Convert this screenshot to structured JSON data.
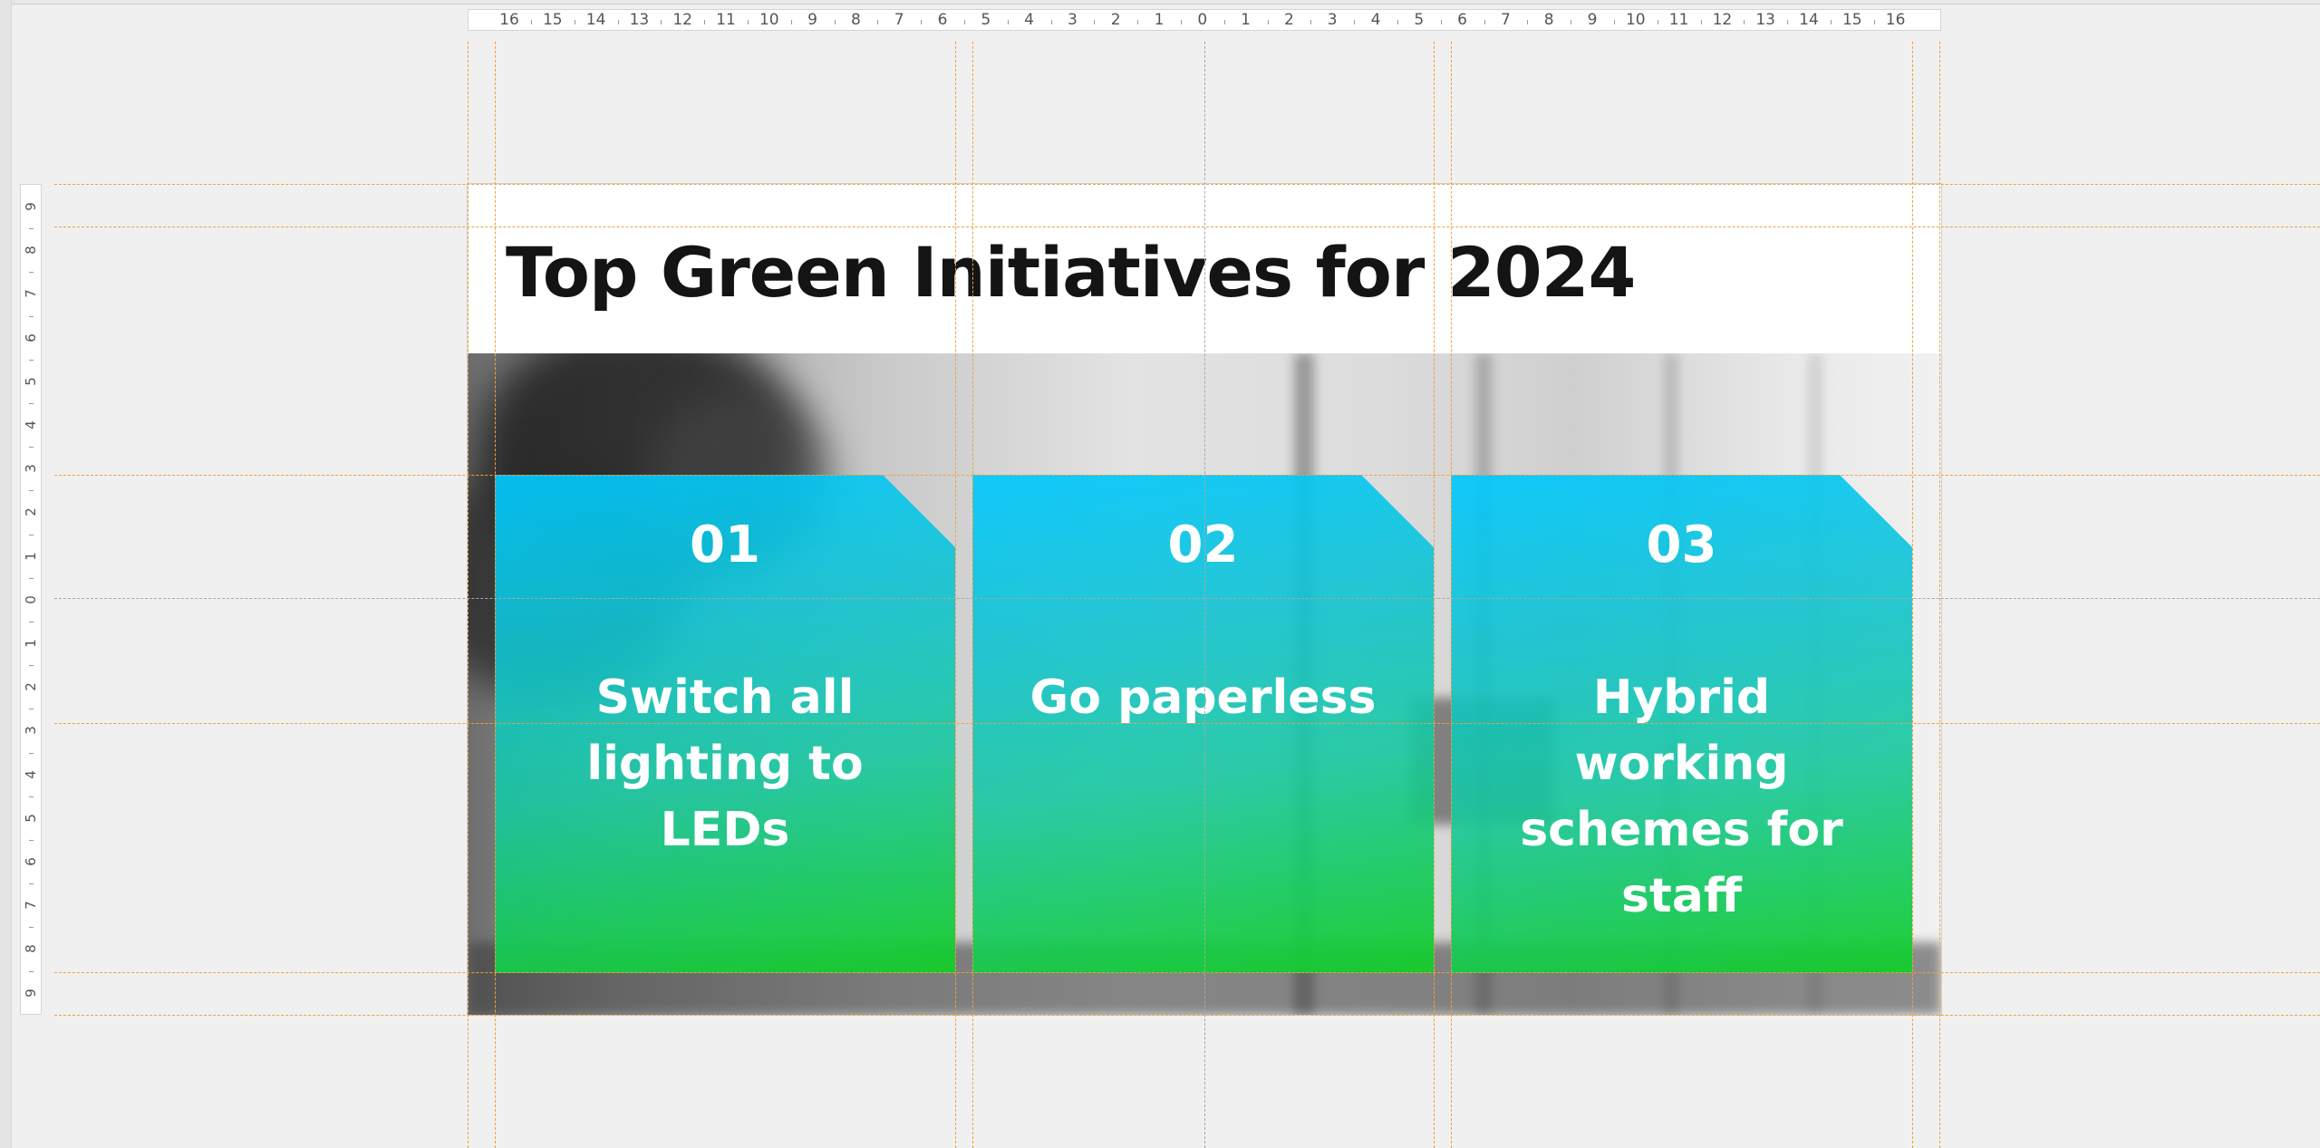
{
  "slide": {
    "title": "Top Green Initiatives for 2024"
  },
  "cards": [
    {
      "number": "01",
      "label": "Switch all lighting to LEDs"
    },
    {
      "number": "02",
      "label": "Go paperless"
    },
    {
      "number": "03",
      "label": "Hybrid working schemes for staff"
    }
  ],
  "ruler": {
    "horizontal_labels": [
      "16",
      "15",
      "14",
      "13",
      "12",
      "11",
      "10",
      "9",
      "8",
      "7",
      "6",
      "5",
      "4",
      "3",
      "2",
      "1",
      "0",
      "1",
      "2",
      "3",
      "4",
      "5",
      "6",
      "7",
      "8",
      "9",
      "10",
      "11",
      "12",
      "13",
      "14",
      "15",
      "16"
    ],
    "vertical_labels": [
      "9",
      "8",
      "7",
      "6",
      "5",
      "4",
      "3",
      "2",
      "1",
      "0",
      "1",
      "2",
      "3",
      "4",
      "5",
      "6",
      "7",
      "8",
      "9"
    ]
  },
  "colors": {
    "guide": "#f0a040",
    "card_top": "#00c8ff",
    "card_bottom": "#14cd28",
    "title": "#141414"
  }
}
